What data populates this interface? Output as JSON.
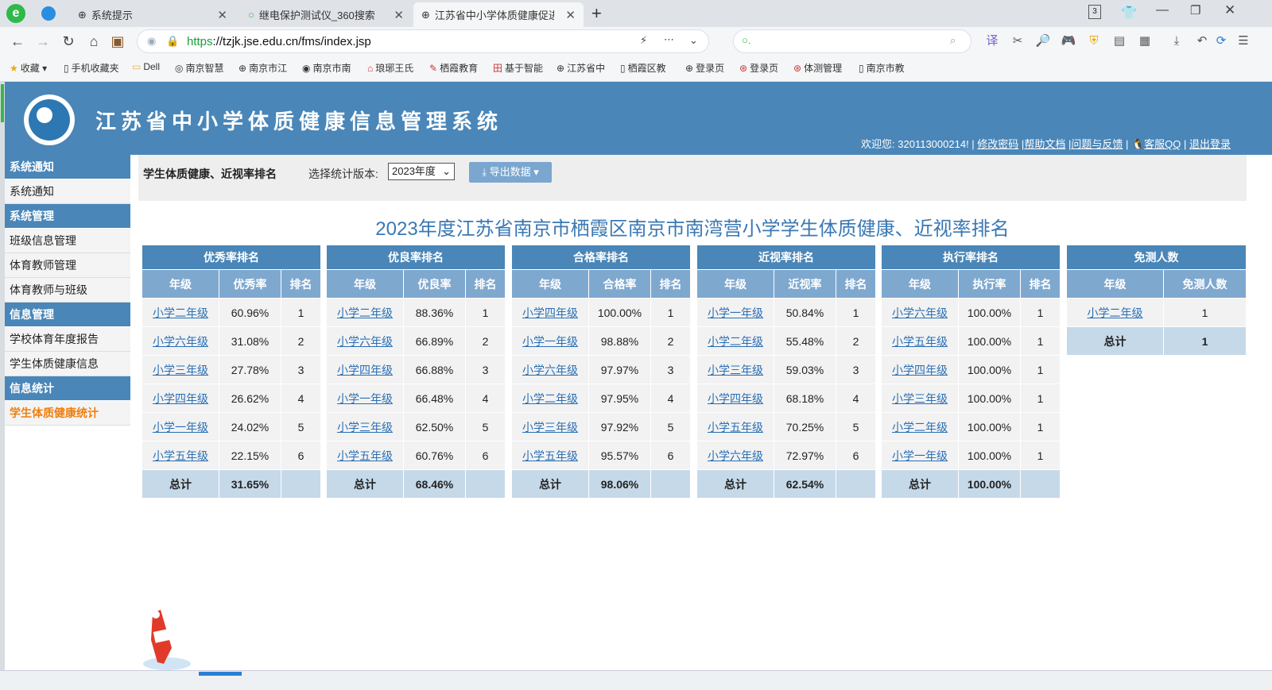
{
  "browser": {
    "tabs": [
      {
        "title": "系统提示"
      },
      {
        "title": "继电保护测试仪_360搜索"
      },
      {
        "title": "江苏省中小学体质健康促进校管理"
      }
    ],
    "tab_count_badge": "3",
    "url_scheme": "https",
    "url_rest": "://tzjk.jse.edu.cn/fms/index.jsp",
    "bookmarks": [
      "收藏",
      "手机收藏夹",
      "Dell",
      "南京智慧",
      "南京市江",
      "南京市南",
      "琅琊王氏",
      "栖霞教育",
      "基于智能",
      "江苏省中",
      "栖霞区教",
      "登录页",
      "登录页",
      "体测管理",
      "南京市教"
    ]
  },
  "header": {
    "site_title": "江苏省中小学体质健康信息管理系统",
    "welcome_prefix": "欢迎您: 320113000214! |",
    "links": [
      "修改密码",
      "帮助文档",
      "问题与反馈",
      "客服QQ",
      "退出登录"
    ]
  },
  "sidebar": {
    "sections": [
      {
        "title": "系统通知",
        "items": [
          "系统通知"
        ]
      },
      {
        "title": "系统管理",
        "items": [
          "班级信息管理",
          "体育教师管理",
          "体育教师与班级"
        ]
      },
      {
        "title": "信息管理",
        "items": [
          "学校体育年度报告",
          "学生体质健康信息"
        ]
      },
      {
        "title": "信息统计",
        "items": [
          "学生体质健康统计"
        ]
      }
    ],
    "active_item": "学生体质健康统计"
  },
  "topbar": {
    "title": "学生体质健康、近视率排名",
    "version_label": "选择统计版本:",
    "version_value": "2023年度",
    "export_label": "导出数据"
  },
  "report": {
    "title": "2023年度江苏省南京市栖霞区南京市南湾营小学学生体质健康、近视率排名",
    "total_label": "总计",
    "tables": [
      {
        "caption": "优秀率排名",
        "columns": [
          "年级",
          "优秀率",
          "排名"
        ],
        "rows": [
          [
            "小学二年级",
            "60.96%",
            "1"
          ],
          [
            "小学六年级",
            "31.08%",
            "2"
          ],
          [
            "小学三年级",
            "27.78%",
            "3"
          ],
          [
            "小学四年级",
            "26.62%",
            "4"
          ],
          [
            "小学一年级",
            "24.02%",
            "5"
          ],
          [
            "小学五年级",
            "22.15%",
            "6"
          ]
        ],
        "total": "31.65%"
      },
      {
        "caption": "优良率排名",
        "columns": [
          "年级",
          "优良率",
          "排名"
        ],
        "rows": [
          [
            "小学二年级",
            "88.36%",
            "1"
          ],
          [
            "小学六年级",
            "66.89%",
            "2"
          ],
          [
            "小学四年级",
            "66.88%",
            "3"
          ],
          [
            "小学一年级",
            "66.48%",
            "4"
          ],
          [
            "小学三年级",
            "62.50%",
            "5"
          ],
          [
            "小学五年级",
            "60.76%",
            "6"
          ]
        ],
        "total": "68.46%"
      },
      {
        "caption": "合格率排名",
        "columns": [
          "年级",
          "合格率",
          "排名"
        ],
        "rows": [
          [
            "小学四年级",
            "100.00%",
            "1"
          ],
          [
            "小学一年级",
            "98.88%",
            "2"
          ],
          [
            "小学六年级",
            "97.97%",
            "3"
          ],
          [
            "小学二年级",
            "97.95%",
            "4"
          ],
          [
            "小学三年级",
            "97.92%",
            "5"
          ],
          [
            "小学五年级",
            "95.57%",
            "6"
          ]
        ],
        "total": "98.06%"
      },
      {
        "caption": "近视率排名",
        "columns": [
          "年级",
          "近视率",
          "排名"
        ],
        "rows": [
          [
            "小学一年级",
            "50.84%",
            "1"
          ],
          [
            "小学二年级",
            "55.48%",
            "2"
          ],
          [
            "小学三年级",
            "59.03%",
            "3"
          ],
          [
            "小学四年级",
            "68.18%",
            "4"
          ],
          [
            "小学五年级",
            "70.25%",
            "5"
          ],
          [
            "小学六年级",
            "72.97%",
            "6"
          ]
        ],
        "total": "62.54%"
      },
      {
        "caption": "执行率排名",
        "columns": [
          "年级",
          "执行率",
          "排名"
        ],
        "rows": [
          [
            "小学六年级",
            "100.00%",
            "1"
          ],
          [
            "小学五年级",
            "100.00%",
            "1"
          ],
          [
            "小学四年级",
            "100.00%",
            "1"
          ],
          [
            "小学三年级",
            "100.00%",
            "1"
          ],
          [
            "小学二年级",
            "100.00%",
            "1"
          ],
          [
            "小学一年级",
            "100.00%",
            "1"
          ]
        ],
        "total": "100.00%"
      },
      {
        "caption": "免测人数",
        "columns": [
          "年级",
          "免测人数"
        ],
        "rows": [
          [
            "小学二年级",
            "1"
          ]
        ],
        "total": "1"
      }
    ]
  },
  "colors": {
    "header_blue": "#4a86b8",
    "column_header": "#7fa8cf",
    "total_row": "#c6d9e9",
    "active_menu": "#f07e0e",
    "report_title": "#3a78b4"
  }
}
